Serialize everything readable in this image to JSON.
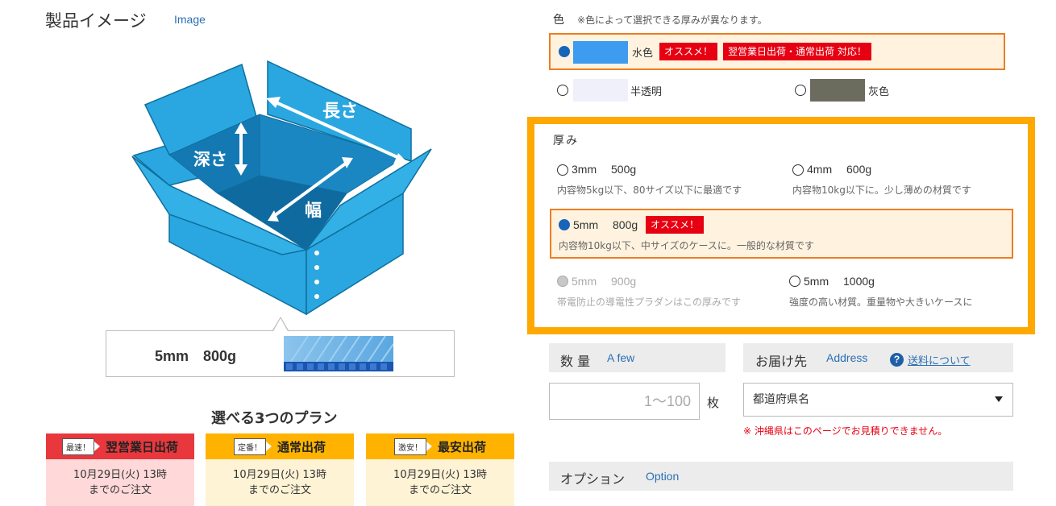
{
  "product_image": {
    "title": "製品イメージ",
    "title_en": "Image",
    "labels": {
      "length": "長さ",
      "depth": "深さ",
      "width": "幅"
    },
    "spec": "5mm　800g"
  },
  "plans": {
    "title": "選べる3つのプラン",
    "items": [
      {
        "tag": "最速！",
        "name": "翌営業日出荷",
        "line1": "10月29日(火) 13時",
        "line2": "までのご注文",
        "head_color": "#e8383d",
        "body_color": "#ffd9d9"
      },
      {
        "tag": "定番！",
        "name": "通常出荷",
        "line1": "10月29日(火) 13時",
        "line2": "までのご注文",
        "head_color": "#ffb300",
        "body_color": "#fff3d6"
      },
      {
        "tag": "激安！",
        "name": "最安出荷",
        "line1": "10月29日(火) 13時",
        "line2": "までのご注文",
        "head_color": "#ffb300",
        "body_color": "#fff3d6"
      }
    ]
  },
  "color": {
    "label": "色",
    "note": "※色によって選択できる厚みが異なります。",
    "options": [
      {
        "name": "水色",
        "swatch": "#3d9cf0",
        "selected": true,
        "badges": [
          "オススメ！",
          "翌営業日出荷・通常出荷 対応！"
        ]
      },
      {
        "name": "半透明",
        "swatch": "#f0f0fa",
        "selected": false
      },
      {
        "name": "灰色",
        "swatch": "#6b6b5e",
        "selected": false
      }
    ]
  },
  "thickness": {
    "title": "厚み",
    "options": [
      {
        "label": "3mm　 500g",
        "desc": "内容物5kg以下、80サイズ以下に最適です",
        "state": "off"
      },
      {
        "label": "4mm　 600g",
        "desc": "内容物10kg以下に。少し薄めの材質です",
        "state": "off"
      },
      {
        "label": "5mm　 800g",
        "desc": "内容物10kg以下、中サイズのケースに。一般的な材質です",
        "state": "on",
        "badge": "オススメ！"
      },
      {
        "label": "5mm　 900g",
        "desc": "帯電防止の導電性プラダンはこの厚みです",
        "state": "disabled"
      },
      {
        "label": "5mm　 1000g",
        "desc": "強度の高い材質。重量物や大きいケースに",
        "state": "off"
      }
    ]
  },
  "quantity": {
    "title": "数 量",
    "title_en": "A few",
    "placeholder": "1〜100",
    "unit": "枚"
  },
  "address": {
    "title": "お届け先",
    "title_en": "Address",
    "help_glyph": "?",
    "shipping_link": "送料について",
    "select_value": "都道府県名",
    "note": "※ 沖縄県はこのページでお見積りできません。"
  },
  "option": {
    "title": "オプション",
    "title_en": "Option"
  }
}
